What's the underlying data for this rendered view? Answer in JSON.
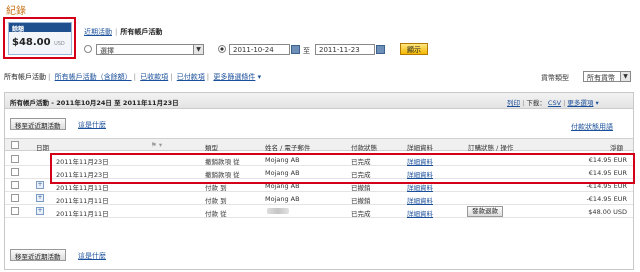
{
  "page": {
    "title": "紀錄"
  },
  "balance": {
    "label": "餘額",
    "amount": "$48.00",
    "currency": "USD"
  },
  "nav_tabs": {
    "recent": "近期活動",
    "all": "所有帳戶活動"
  },
  "search": {
    "select_value": "選擇",
    "date_from": "2011-10-24",
    "date_to_label": "至",
    "date_to": "2011-11-23",
    "show_button": "顯示"
  },
  "filters": {
    "items": [
      "所有帳戶活動",
      "所有帳戶活動（含餘額）",
      "已收款項",
      "已付款項",
      "更多篩選條件"
    ],
    "currency_label": "貨幣類型",
    "currency_value": "所有貨幣"
  },
  "panel": {
    "title": "所有帳戶活動 - 2011年10月24日 至 2011年11月23日",
    "print": "列印",
    "download_label": "下載：",
    "csv": "CSV",
    "more_options": "更多選項",
    "archive_button": "移至近近期活動",
    "whats_this": "這是什麼",
    "payment_status_help": "付款狀態用語"
  },
  "table": {
    "headers": [
      "日期",
      "類型",
      "姓名 / 電子郵件",
      "付款狀態",
      "詳細資料",
      "訂購狀態 / 操作",
      "淨額"
    ],
    "rows": [
      {
        "date": "2011年11月23日",
        "type": "撤銷款項 從",
        "name": "Mojang AB",
        "status": "已完成",
        "details": "詳細資料",
        "action": "",
        "net": "€14.95 EUR",
        "expand": false,
        "blurred": false
      },
      {
        "date": "2011年11月23日",
        "type": "撤銷款項 從",
        "name": "Mojang AB",
        "status": "已完成",
        "details": "詳細資料",
        "action": "",
        "net": "€14.95 EUR",
        "expand": false,
        "blurred": false
      },
      {
        "date": "2011年11月11日",
        "type": "付款 到",
        "name": "Mojang AB",
        "status": "已撤銷",
        "details": "詳細資料",
        "action": "",
        "net": "-€14.95 EUR",
        "expand": true,
        "blurred": false
      },
      {
        "date": "2011年11月11日",
        "type": "付款 到",
        "name": "Mojang AB",
        "status": "已撤銷",
        "details": "詳細資料",
        "action": "",
        "net": "-€14.95 EUR",
        "expand": true,
        "blurred": false
      },
      {
        "date": "2011年11月11日",
        "type": "付款 從",
        "name": "",
        "status": "已完成",
        "details": "詳細資料",
        "action": "發款退款",
        "net": "$48.00 USD",
        "expand": true,
        "blurred": true
      }
    ]
  },
  "colors": {
    "highlight": "#d4001a",
    "link": "#1a4f9a",
    "title": "#c8741c"
  }
}
